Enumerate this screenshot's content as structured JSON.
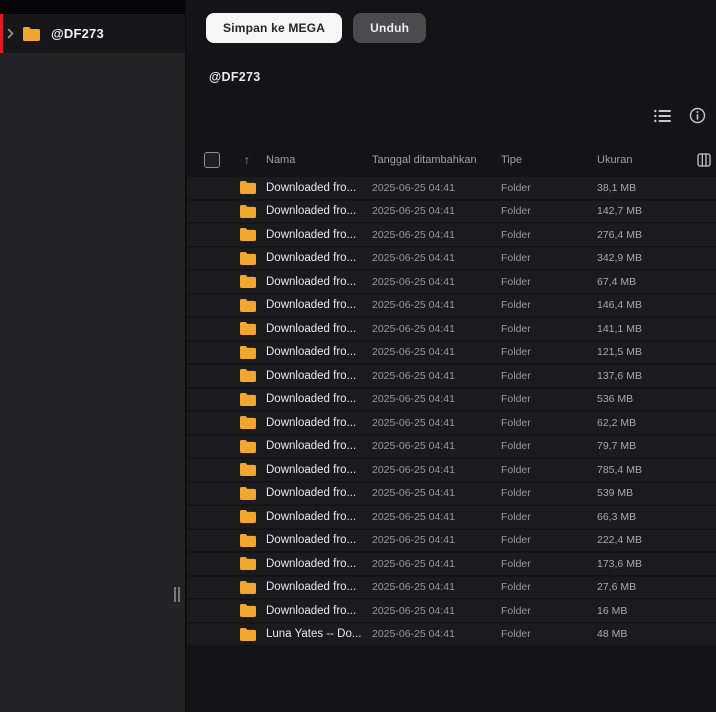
{
  "colors": {
    "accent_red": "#DD1D26",
    "folder_orange": "#F0A62F",
    "sidebar_bg": "#232327",
    "main_bg": "#141416",
    "row_bg": "#1B1B1E"
  },
  "sidebar": {
    "item": {
      "label": "@DF273",
      "icon": "folder-icon",
      "chevron": "chevron-right-icon"
    }
  },
  "toolbar": {
    "save_label": "Simpan ke MEGA",
    "download_label": "Unduh"
  },
  "header": {
    "title": "@DF273"
  },
  "view_controls": {
    "list_view": "list-view-icon",
    "info": "info-circle-icon"
  },
  "table": {
    "sort_icon": "↑",
    "columns": {
      "name": "Nama",
      "date": "Tanggal ditambahkan",
      "type": "Tipe",
      "size": "Ukuran",
      "settings_icon": "columns-icon"
    },
    "rows": [
      {
        "name": "Downloaded fro...",
        "date": "2025-06-25 04:41",
        "type": "Folder",
        "size": "38,1 MB"
      },
      {
        "name": "Downloaded fro...",
        "date": "2025-06-25 04:41",
        "type": "Folder",
        "size": "142,7 MB"
      },
      {
        "name": "Downloaded fro...",
        "date": "2025-06-25 04:41",
        "type": "Folder",
        "size": "276,4 MB"
      },
      {
        "name": "Downloaded fro...",
        "date": "2025-06-25 04:41",
        "type": "Folder",
        "size": "342,9 MB"
      },
      {
        "name": "Downloaded fro...",
        "date": "2025-06-25 04:41",
        "type": "Folder",
        "size": "67,4 MB"
      },
      {
        "name": "Downloaded fro...",
        "date": "2025-06-25 04:41",
        "type": "Folder",
        "size": "146,4 MB"
      },
      {
        "name": "Downloaded fro...",
        "date": "2025-06-25 04:41",
        "type": "Folder",
        "size": "141,1 MB"
      },
      {
        "name": "Downloaded fro...",
        "date": "2025-06-25 04:41",
        "type": "Folder",
        "size": "121,5 MB"
      },
      {
        "name": "Downloaded fro...",
        "date": "2025-06-25 04:41",
        "type": "Folder",
        "size": "137,6 MB"
      },
      {
        "name": "Downloaded fro...",
        "date": "2025-06-25 04:41",
        "type": "Folder",
        "size": "536 MB"
      },
      {
        "name": "Downloaded fro...",
        "date": "2025-06-25 04:41",
        "type": "Folder",
        "size": "62,2 MB"
      },
      {
        "name": "Downloaded fro...",
        "date": "2025-06-25 04:41",
        "type": "Folder",
        "size": "79,7 MB"
      },
      {
        "name": "Downloaded fro...",
        "date": "2025-06-25 04:41",
        "type": "Folder",
        "size": "785,4 MB"
      },
      {
        "name": "Downloaded fro...",
        "date": "2025-06-25 04:41",
        "type": "Folder",
        "size": "539 MB"
      },
      {
        "name": "Downloaded fro...",
        "date": "2025-06-25 04:41",
        "type": "Folder",
        "size": "66,3 MB"
      },
      {
        "name": "Downloaded fro...",
        "date": "2025-06-25 04:41",
        "type": "Folder",
        "size": "222,4 MB"
      },
      {
        "name": "Downloaded fro...",
        "date": "2025-06-25 04:41",
        "type": "Folder",
        "size": "173,6 MB"
      },
      {
        "name": "Downloaded fro...",
        "date": "2025-06-25 04:41",
        "type": "Folder",
        "size": "27,6 MB"
      },
      {
        "name": "Downloaded fro...",
        "date": "2025-06-25 04:41",
        "type": "Folder",
        "size": "16 MB"
      },
      {
        "name": "Luna Yates -- Do...",
        "date": "2025-06-25 04:41",
        "type": "Folder",
        "size": "48 MB"
      }
    ]
  }
}
